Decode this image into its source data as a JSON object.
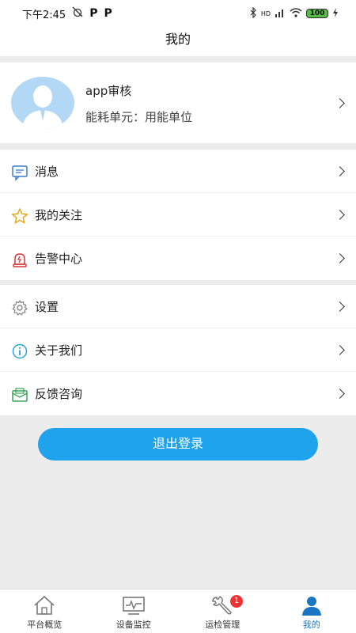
{
  "status_bar": {
    "time": "下午2:45",
    "notif_icons": [
      "P",
      "P"
    ],
    "network": "HD",
    "battery": "100"
  },
  "header": {
    "title": "我的"
  },
  "profile": {
    "name": "app审核",
    "unit_text": "能耗单元：用能单位"
  },
  "menu_group_1": [
    {
      "label": "消息",
      "icon": "message-icon"
    },
    {
      "label": "我的关注",
      "icon": "star-icon"
    },
    {
      "label": "告警中心",
      "icon": "alarm-icon"
    }
  ],
  "menu_group_2": [
    {
      "label": "设置",
      "icon": "gear-icon"
    },
    {
      "label": "关于我们",
      "icon": "info-icon"
    },
    {
      "label": "反馈咨询",
      "icon": "mail-icon"
    }
  ],
  "logout_label": "退出登录",
  "tabs": [
    {
      "label": "平台概览",
      "icon": "home-icon"
    },
    {
      "label": "设备监控",
      "icon": "monitor-icon"
    },
    {
      "label": "运检管理",
      "icon": "wrench-icon",
      "badge": "1"
    },
    {
      "label": "我的",
      "icon": "user-icon"
    }
  ],
  "colors": {
    "accent": "#1ea3ec",
    "tab_active": "#1a75c3",
    "badge": "#e33333"
  }
}
